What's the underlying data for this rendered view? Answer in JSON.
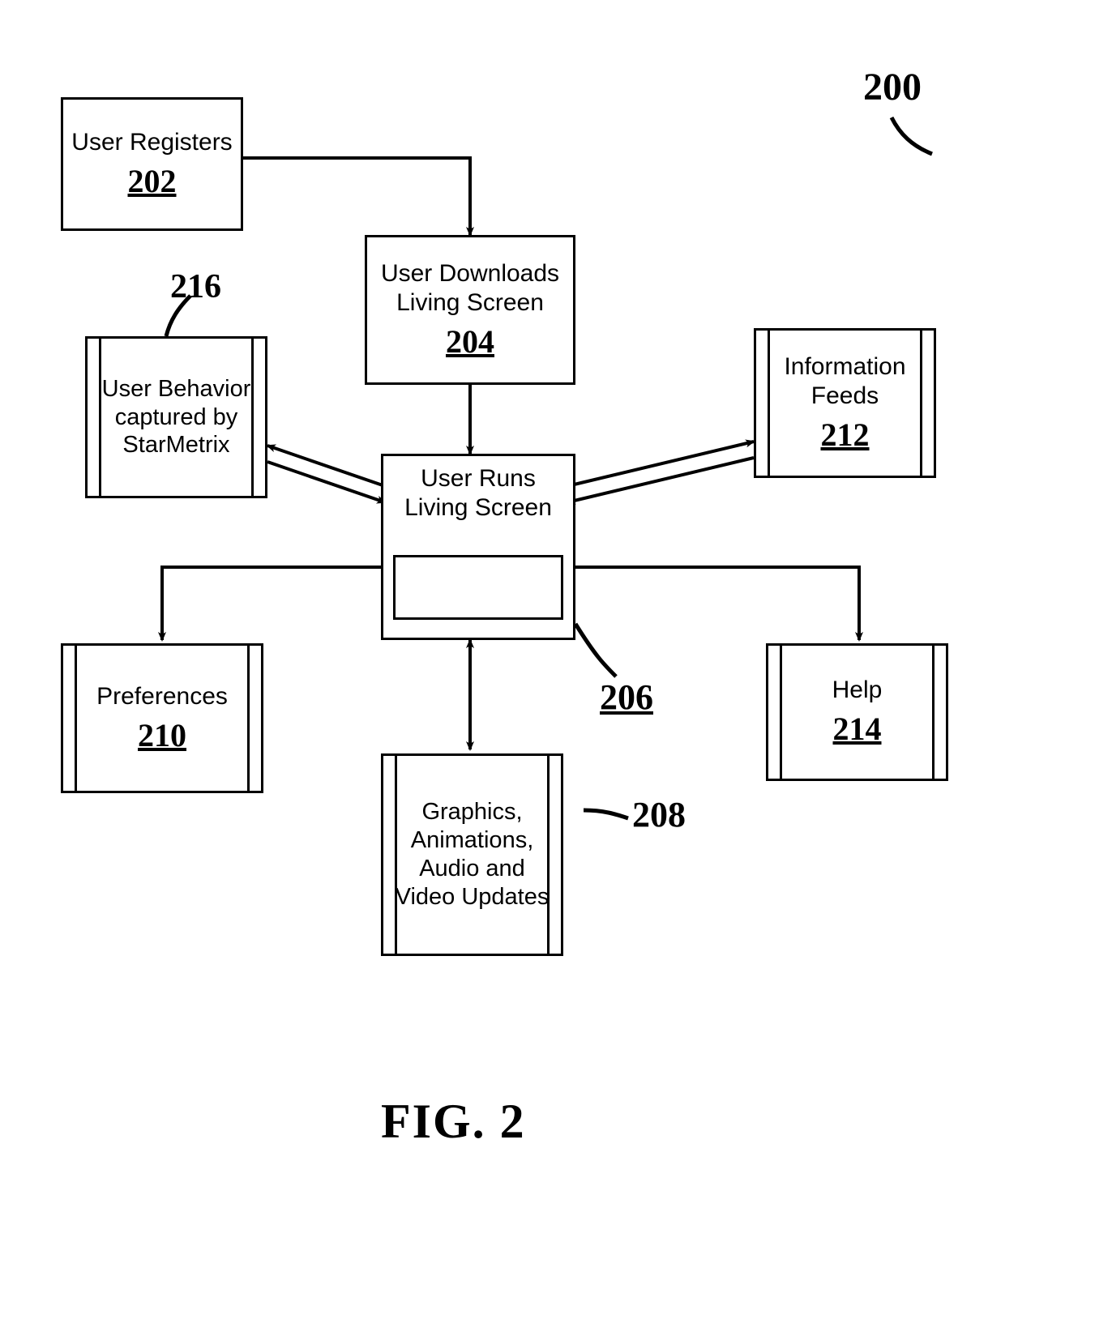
{
  "figure": {
    "number_label": "200",
    "caption": "FIG. 2"
  },
  "nodes": {
    "registers": {
      "title": "User Registers",
      "ref": "202"
    },
    "downloads": {
      "title": "User Downloads Living Screen",
      "ref": "204"
    },
    "runs": {
      "title": "User Runs Living Screen",
      "ref": "206"
    },
    "updates": {
      "title": "Graphics, Animations, Audio and Video Updates",
      "ref": "208"
    },
    "preferences": {
      "title": "Preferences",
      "ref": "210"
    },
    "feeds": {
      "title": "Information Feeds",
      "ref": "212"
    },
    "help": {
      "title": "Help",
      "ref": "214"
    },
    "behavior": {
      "title": "User Behavior captured by StarMetrix",
      "ref": "216"
    }
  }
}
